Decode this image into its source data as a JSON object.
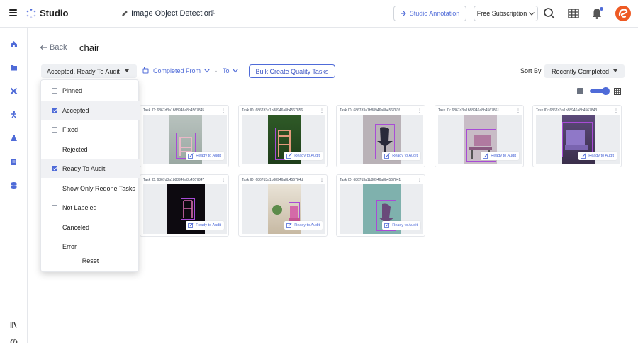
{
  "header": {
    "brand": "Studio",
    "project_title": "Image Object Detection",
    "annotation_button": "Studio Annotation",
    "subscription_button": "Free Subscription",
    "accent_color": "#4f6bd8",
    "avatar_color": "#ee5a24"
  },
  "page": {
    "back_label": "Back",
    "title": "chair"
  },
  "filters": {
    "status_selected": "Accepted, Ready To Audit",
    "date_from_label": "Completed From",
    "date_separator": "-",
    "date_to_label": "To",
    "bulk_button": "Bulk Create Quality Tasks",
    "sort_label": "Sort By",
    "sort_selected": "Recently Completed"
  },
  "status_options": [
    {
      "label": "Pinned",
      "checked": false
    },
    {
      "label": "Accepted",
      "checked": true
    },
    {
      "label": "Fixed",
      "checked": false
    },
    {
      "label": "Rejected",
      "checked": false
    },
    {
      "label": "Ready To Audit",
      "checked": true
    },
    {
      "label": "Show Only Redone Tasks",
      "checked": false
    },
    {
      "label": "Not Labeled",
      "checked": false
    },
    {
      "label": "Canceled",
      "checked": false
    },
    {
      "label": "Error",
      "checked": false
    }
  ],
  "reset_label": "Reset",
  "tasks": [
    {
      "task_id": "Task ID: 6867d3a1b88946a8b4567845",
      "status": "Ready to Audit"
    },
    {
      "task_id": "Task ID: 6867d3a1b88946a8b4567856",
      "status": "Ready to Audit"
    },
    {
      "task_id": "Task ID: 6867d3a1b88946a8b456783f",
      "status": "Ready to Audit"
    },
    {
      "task_id": "Task ID: 6867d3a1b88946a8b4567861",
      "status": "Ready to Audit"
    },
    {
      "task_id": "Task ID: 6867d3a1b88946a8b4567843",
      "status": "Ready to Audit"
    },
    {
      "task_id": "Task ID: 6867d3a1b88946a8b4567847",
      "status": "Ready to Audit"
    },
    {
      "task_id": "Task ID: 6867d3a1b88946a8b456784d",
      "status": "Ready to Audit"
    },
    {
      "task_id": "Task ID: 6867d3a1b88946a8b4567841",
      "status": "Ready to Audit"
    }
  ]
}
